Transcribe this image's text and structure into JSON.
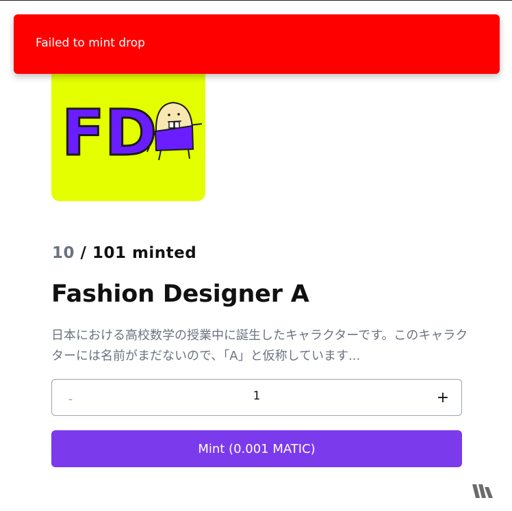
{
  "toast": {
    "message": "Failed to mint drop"
  },
  "artwork": {
    "letters": "FD"
  },
  "supply": {
    "minted": "10",
    "separator": " / ",
    "total_label": "101 minted"
  },
  "drop": {
    "title": "Fashion Designer A",
    "description": "日本における高校数学の授業中に誕生したキャラクターです。このキャラクターには名前がまだないので、「A」と仮称しています..."
  },
  "quantity": {
    "decrement_label": "-",
    "value": "1",
    "increment_label": "+"
  },
  "mint": {
    "label": "Mint (0.001 MATIC)"
  },
  "colors": {
    "toast_bg": "#ff0000",
    "artwork_bg": "#e3ff00",
    "artwork_letters": "#6a1dff",
    "mint_button": "#7c3aed",
    "muted_text": "#6b7280"
  },
  "icons": {
    "brand": "thirdweb-logo-icon"
  }
}
